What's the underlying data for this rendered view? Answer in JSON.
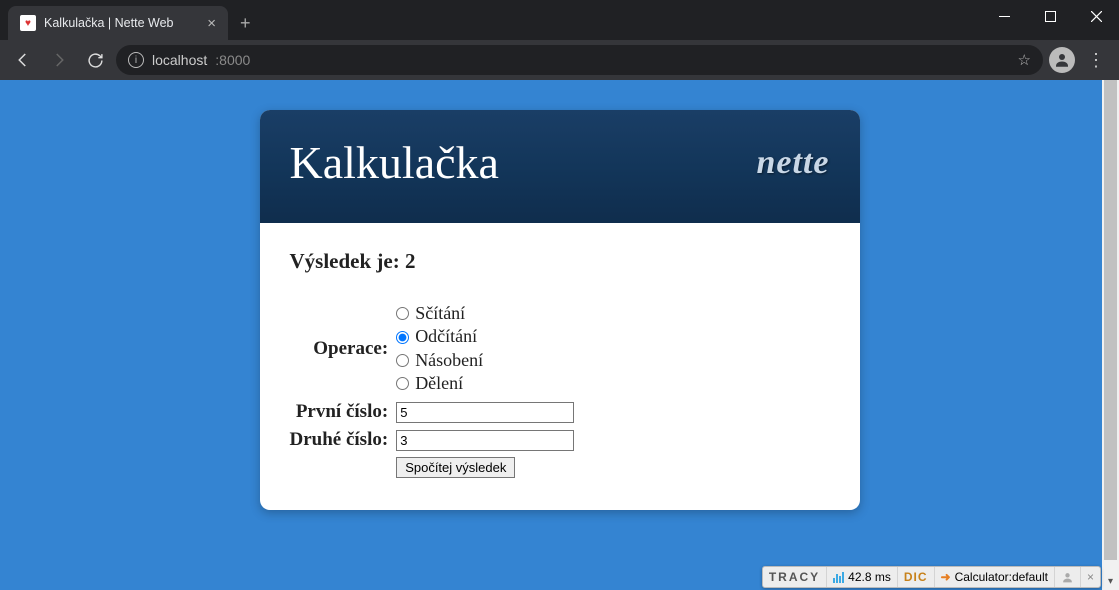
{
  "browser": {
    "tab_title": "Kalkulačka | Nette Web",
    "url_host": "localhost",
    "url_port": ":8000"
  },
  "page": {
    "header_title": "Kalkulačka",
    "brand": "nette",
    "result_label": "Výsledek je: ",
    "result_value": "2",
    "form": {
      "operation_label": "Operace:",
      "operations": {
        "add": "Sčítání",
        "sub": "Odčítání",
        "mul": "Násobení",
        "div": "Dělení"
      },
      "selected_operation": "sub",
      "first_label": "První číslo:",
      "first_value": "5",
      "second_label": "Druhé číslo:",
      "second_value": "3",
      "submit_label": "Spočítej výsledek"
    }
  },
  "tracy": {
    "logo": "TRACY",
    "time": "42.8 ms",
    "dic": "DIC",
    "route": "Calculator:default"
  }
}
